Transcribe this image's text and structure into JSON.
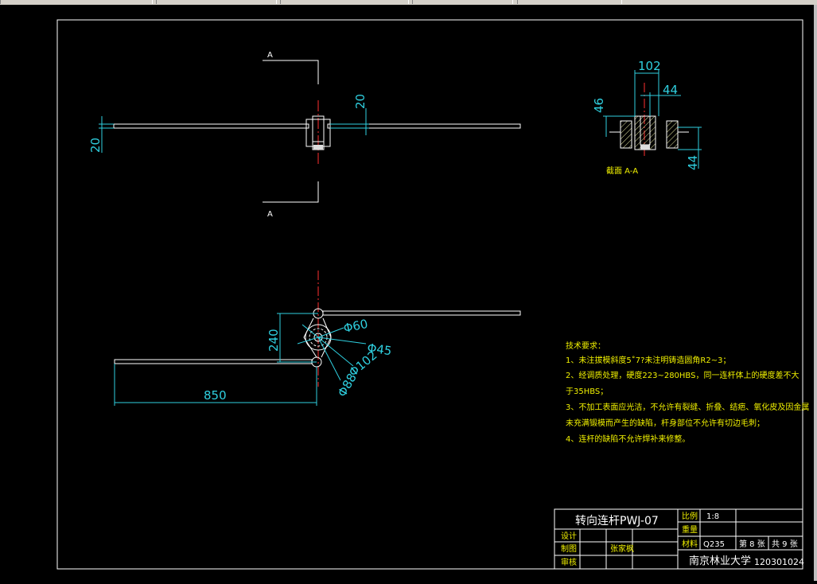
{
  "section_label": "A",
  "section_title": "截面  A-A",
  "dims": {
    "top_left_20": "20",
    "top_hub_20": "20",
    "section_102": "102",
    "section_44_top": "44",
    "section_46": "46",
    "section_44_side": "44",
    "bottom_240": "240",
    "bottom_850": "850",
    "d60": "Φ60",
    "d45": "Φ45",
    "d102": "Φ102",
    "d88": "Φ88"
  },
  "tech": {
    "heading": "技术要求：",
    "lines": [
      "1、未注拔模斜度5˚7?未注明铸造圆角R2~3；",
      "2、经调质处理，硬度223~280HBS，同一连杆体上的硬度差不大",
      "于35HBS；",
      "3、不加工表面应光洁，不允许有裂缝、折叠、结疤、氧化皮及因金属",
      "未充满锻模而产生的缺陷，杆身部位不允许有切边毛刺；",
      "4、连杆的缺陷不允许焊补来修整。"
    ]
  },
  "title_block": {
    "part_name": "转向连杆PWJ-07",
    "scale_label": "比例",
    "scale_value": "1:8",
    "weight_label": "重量",
    "material_label": "材料",
    "material_value": "Q235",
    "sheet_no": "第 8 张",
    "sheet_total": "共 9 张",
    "design_label": "设计",
    "draw_label": "制图",
    "draw_name": "张家枫",
    "check_label": "审核",
    "school": "南京林业大学",
    "student_id": "120301024"
  }
}
